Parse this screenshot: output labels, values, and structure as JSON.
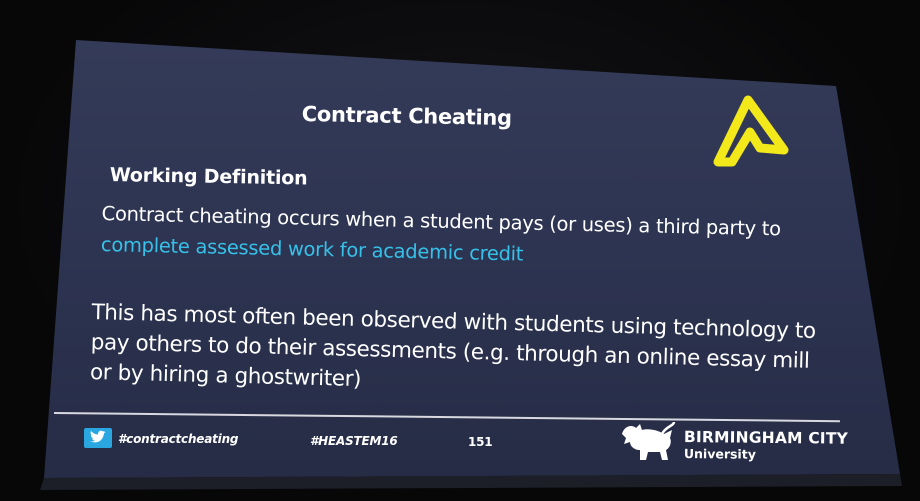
{
  "slide": {
    "title": "Contract Cheating",
    "subheading": "Working Definition",
    "definition_part1": "Contract cheating occurs when a student pays (or uses) a third party to ",
    "definition_highlight": "complete assessed work for academic credit",
    "paragraph": "This has most often been observed with students using technology to pay others to do their assessments (e.g. through an online essay mill or by hiring a ghostwriter)"
  },
  "footer": {
    "hashtag": "#contractcheating",
    "event": "#HEASTEM16",
    "slide_number": "151",
    "university_name": "BIRMINGHAM CITY",
    "university_sub": "University",
    "twitter_icon": "twitter-bird-icon",
    "crest_icon": "lion-crest-icon"
  },
  "colors": {
    "slide_background": "#2d3450",
    "text": "#ffffff",
    "highlight": "#37c0e8",
    "logo": "#f2e81a",
    "twitter": "#2aa7e0"
  }
}
